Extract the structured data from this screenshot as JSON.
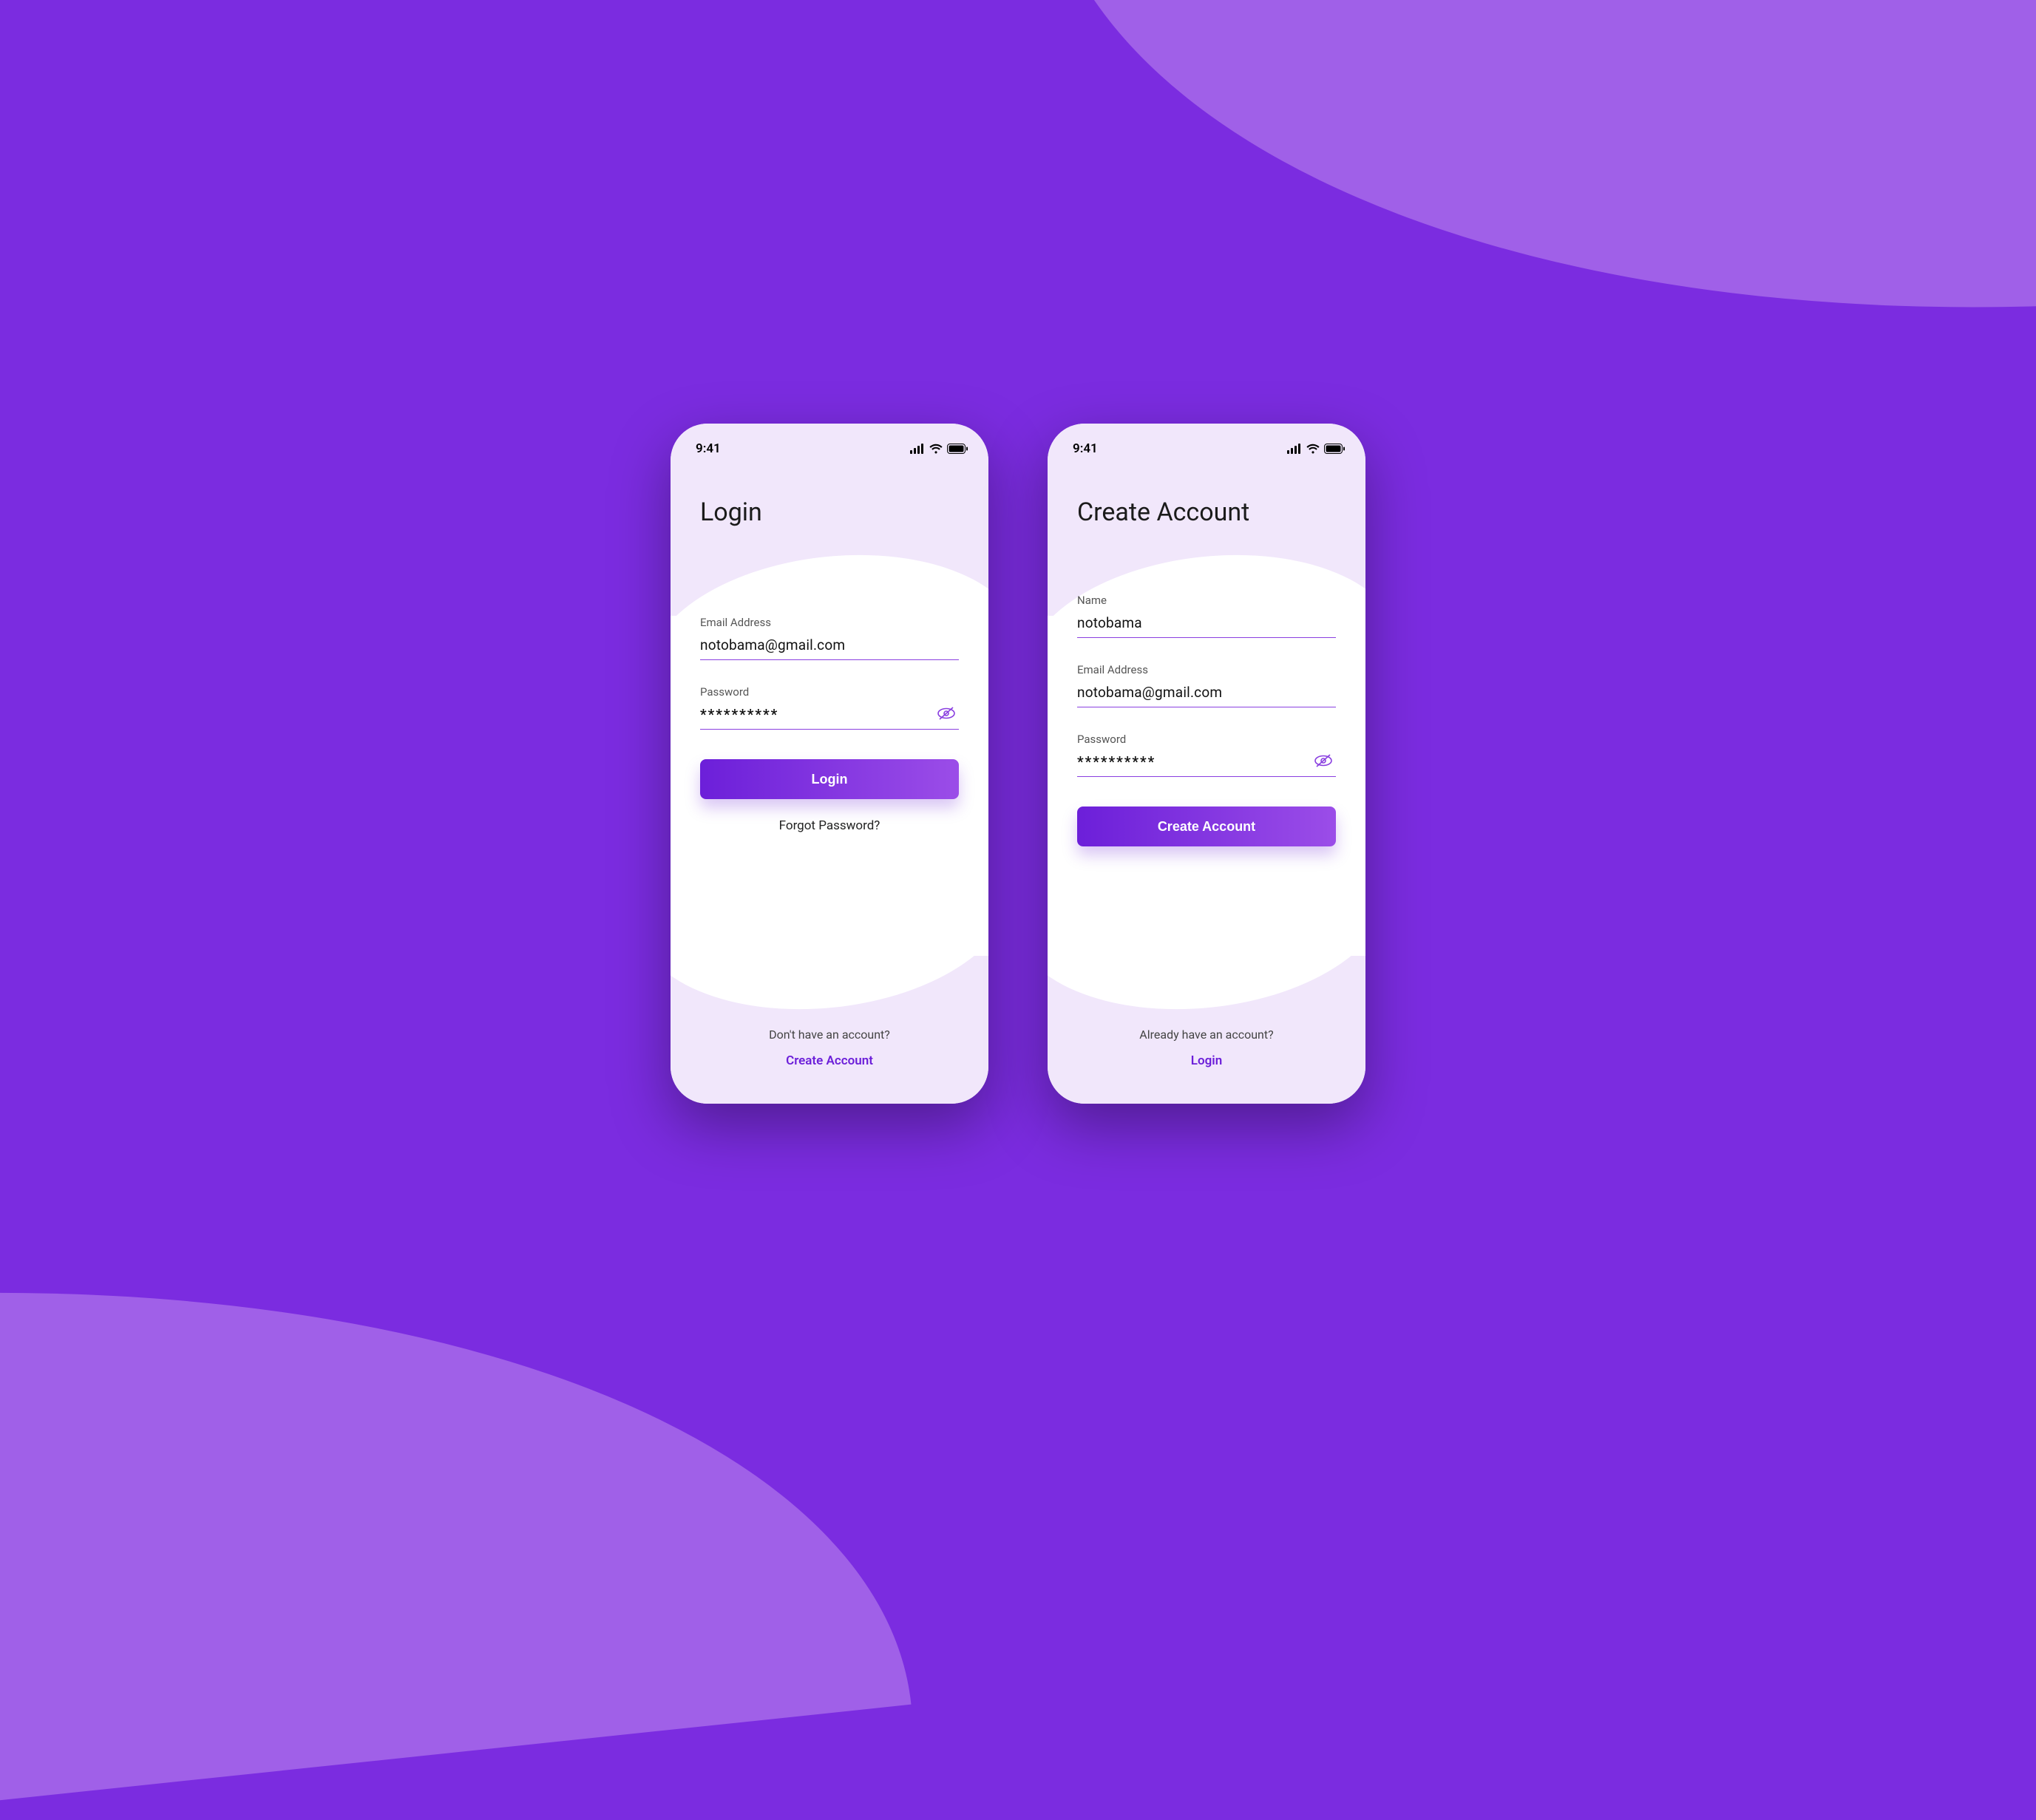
{
  "status": {
    "time": "9:41"
  },
  "login": {
    "title": "Login",
    "email_label": "Email Address",
    "email_value": "notobama@gmail.com",
    "password_label": "Password",
    "password_value": "**********",
    "button": "Login",
    "forgot": "Forgot Password?",
    "footer_question": "Don't have an account?",
    "footer_link": "Create Account"
  },
  "signup": {
    "title": "Create Account",
    "name_label": "Name",
    "name_value": "notobama",
    "email_label": "Email Address",
    "email_value": "notobama@gmail.com",
    "password_label": "Password",
    "password_value": "**********",
    "button": "Create Account",
    "footer_question": "Already have an account?",
    "footer_link": "Login"
  },
  "colors": {
    "primary": "#6c1fd9",
    "primary_light": "#9b4de8",
    "bg_dark": "#7b2ce0",
    "bg_light": "#a060e8",
    "lilac": "#f1e7fb"
  }
}
